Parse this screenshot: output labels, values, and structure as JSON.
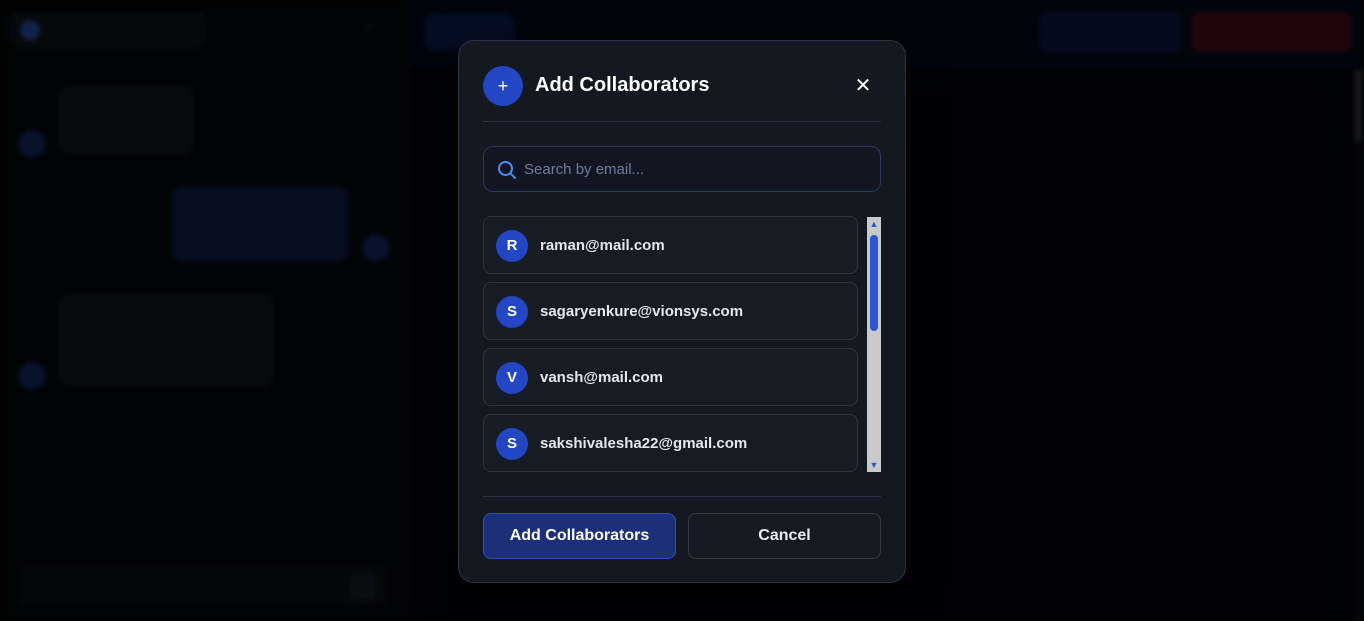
{
  "modal": {
    "title": "Add Collaborators",
    "header_icon": "+",
    "close_glyph": "✕",
    "search": {
      "placeholder": "Search by email..."
    },
    "users": [
      {
        "initial": "R",
        "email": "raman@mail.com"
      },
      {
        "initial": "S",
        "email": "sagaryenkure@vionsys.com"
      },
      {
        "initial": "V",
        "email": "vansh@mail.com"
      },
      {
        "initial": "S",
        "email": "sakshivalesha22@gmail.com"
      }
    ],
    "add_button": "Add Collaborators",
    "cancel_button": "Cancel"
  },
  "colors": {
    "accent": "#2246c4",
    "modal_bg": "#141820",
    "scrollbar_thumb": "#2a56d6"
  },
  "icons": [
    "plus-icon",
    "close-icon",
    "search-icon",
    "scroll-up-arrow-icon",
    "scroll-down-arrow-icon"
  ]
}
